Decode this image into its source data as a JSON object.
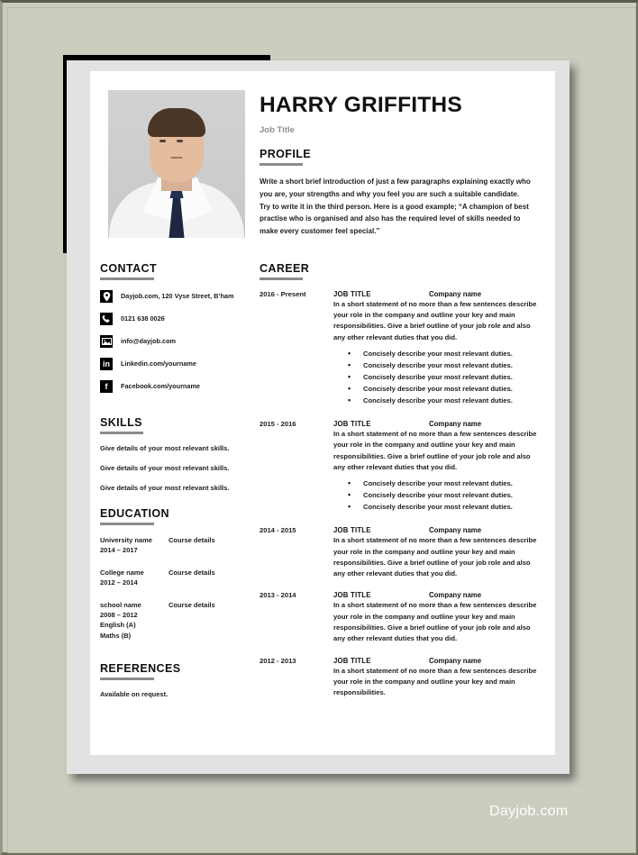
{
  "watermark": "Dayjob.com",
  "header": {
    "name": "HARRY GRIFFITHS",
    "job_title": "Job Title"
  },
  "profile": {
    "heading": "PROFILE",
    "text": "Write a short brief introduction of just a few paragraphs explaining exactly who you are, your strengths and why you feel you are such a suitable candidate. Try to write it in the third person. Here is a good example; “A champion of best practise who is organised and also has the required level of skills needed to make every customer feel special.”"
  },
  "contact": {
    "heading": "CONTACT",
    "items": [
      {
        "icon": "location-pin-icon",
        "text": "Dayjob.com, 120 Vyse Street, B’ham"
      },
      {
        "icon": "phone-icon",
        "text": "0121 638 0026"
      },
      {
        "icon": "email-icon",
        "text": "info@dayjob.com"
      },
      {
        "icon": "linkedin-icon",
        "text": "Linkedin.com/yourname"
      },
      {
        "icon": "facebook-icon",
        "text": "Facebook.com/yourname"
      }
    ]
  },
  "skills": {
    "heading": "SKILLS",
    "items": [
      "Give details of your most relevant skills.",
      "Give details of your most relevant skills.",
      "Give details of your most relevant skills."
    ]
  },
  "education": {
    "heading": "EDUCATION",
    "entries": [
      {
        "institution": "University name",
        "dates": "2014 – 2017",
        "extra": "",
        "course": "Course details"
      },
      {
        "institution": "College name",
        "dates": "2012 – 2014",
        "extra": "",
        "course": "Course details"
      },
      {
        "institution": "school name",
        "dates": "2008 – 2012",
        "extra": "English (A)\nMaths (B)",
        "course": "Course details"
      }
    ]
  },
  "references": {
    "heading": "REFERENCES",
    "text": "Available on request."
  },
  "career": {
    "heading": "CAREER",
    "entries": [
      {
        "dates": "2016 - Present",
        "job_title": "JOB TITLE",
        "company": "Company name",
        "description": "In a short statement of no more than a few sentences describe your role in the company and outline your key and main responsibilities. Give a brief outline of your job role and also any other relevant duties that you did.",
        "duties": [
          "Concisely describe your most relevant duties.",
          "Concisely describe your most relevant duties.",
          "Concisely describe your most relevant duties.",
          "Concisely describe your most relevant duties.",
          "Concisely describe your most relevant duties."
        ]
      },
      {
        "dates": "2015 - 2016",
        "job_title": "JOB TITLE",
        "company": "Company name",
        "description": "In a short statement of no more than a few sentences describe your role in the company and outline your key and main responsibilities. Give a brief outline of your job role and also any other relevant duties that you did.",
        "duties": [
          "Concisely describe your most relevant duties.",
          "Concisely describe your most relevant duties.",
          "Concisely describe your most relevant duties."
        ]
      },
      {
        "dates": "2014 - 2015",
        "job_title": "JOB TITLE",
        "company": "Company name",
        "description": "In a short statement of no more than a few sentences describe your role in the company and outline your key and main responsibilities. Give a brief outline of your job role and also any other relevant duties that you did.",
        "duties": []
      },
      {
        "dates": "2013 - 2014",
        "job_title": "JOB TITLE",
        "company": "Company name",
        "description": "In a short statement of no more than a few sentences describe your role in the company and outline your key and main responsibilities. Give a brief outline of your job role and also any other relevant duties that you did.",
        "duties": []
      },
      {
        "dates": "2012 - 2013",
        "job_title": "JOB TITLE",
        "company": "Company name",
        "description": "In a short statement of no more than a few sentences describe your role in the company and outline your key and main responsibilities.",
        "duties": []
      }
    ]
  }
}
